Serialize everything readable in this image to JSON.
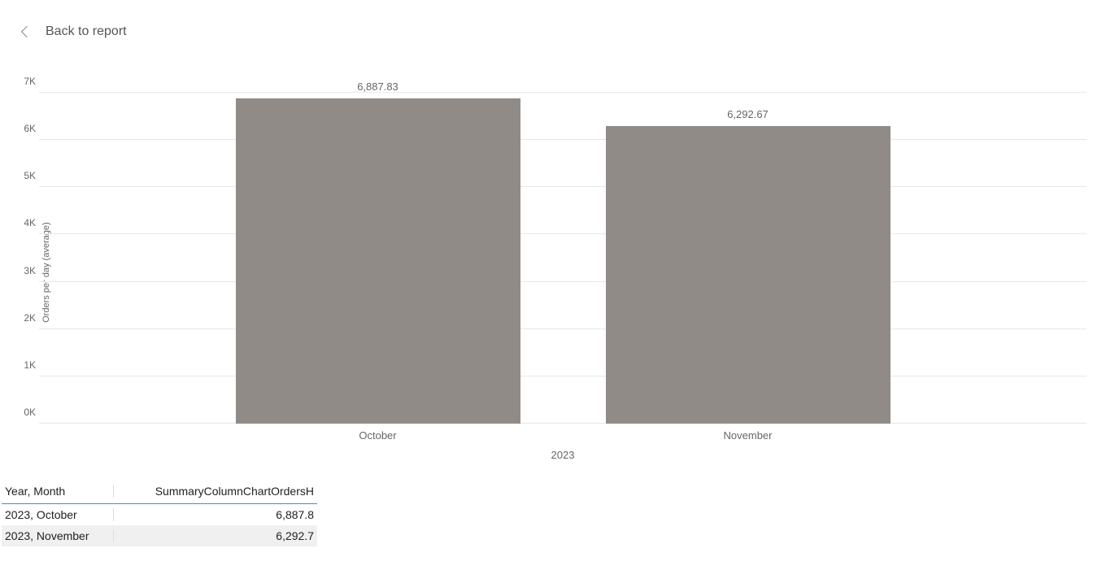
{
  "header": {
    "back_label": "Back to report"
  },
  "chart_data": {
    "type": "bar",
    "title": "",
    "ylabel": "Orders per day (average)",
    "xlabel": "",
    "x_group": "2023",
    "categories": [
      "October",
      "November"
    ],
    "values": [
      6887.83,
      6292.67
    ],
    "value_labels": [
      "6,887.83",
      "6,292.67"
    ],
    "ylim": [
      0,
      7000
    ],
    "y_ticks": [
      {
        "v": 0,
        "label": "0K"
      },
      {
        "v": 1000,
        "label": "1K"
      },
      {
        "v": 2000,
        "label": "2K"
      },
      {
        "v": 3000,
        "label": "3K"
      },
      {
        "v": 4000,
        "label": "4K"
      },
      {
        "v": 5000,
        "label": "5K"
      },
      {
        "v": 6000,
        "label": "6K"
      },
      {
        "v": 7000,
        "label": "7K"
      }
    ]
  },
  "table": {
    "columns": [
      "Year, Month",
      "SummaryColumnChartOrdersH"
    ],
    "rows": [
      {
        "label": "2023, October",
        "value": "6,887.8"
      },
      {
        "label": "2023, November",
        "value": "6,292.7"
      }
    ]
  }
}
